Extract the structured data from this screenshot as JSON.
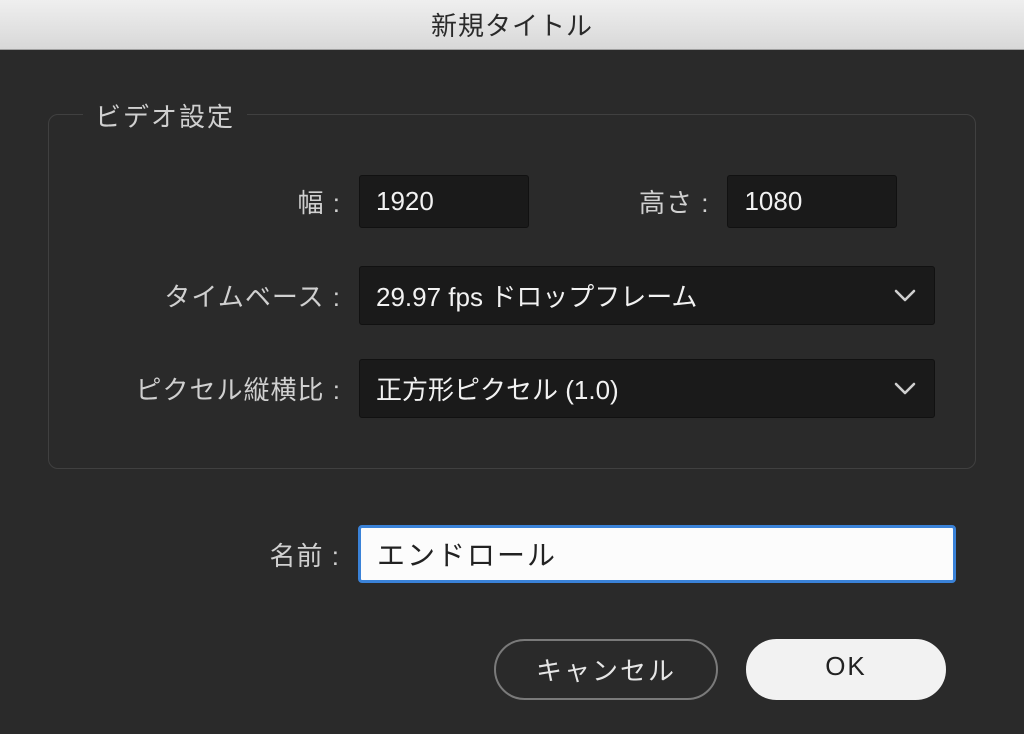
{
  "title": "新規タイトル",
  "videoSettings": {
    "legend": "ビデオ設定",
    "widthLabel": "幅 :",
    "widthValue": "1920",
    "heightLabel": "高さ :",
    "heightValue": "1080",
    "timebaseLabel": "タイムベース :",
    "timebaseValue": "29.97 fps ドロップフレーム",
    "pixelAspectLabel": "ピクセル縦横比 :",
    "pixelAspectValue": "正方形ピクセル (1.0)"
  },
  "nameLabel": "名前 :",
  "nameValue": "エンドロール",
  "buttons": {
    "cancel": "キャンセル",
    "ok": "OK"
  },
  "colors": {
    "accent": "#3a82d8",
    "bodyBg": "#2a2a2a",
    "inputBg": "#1a1a1a"
  }
}
